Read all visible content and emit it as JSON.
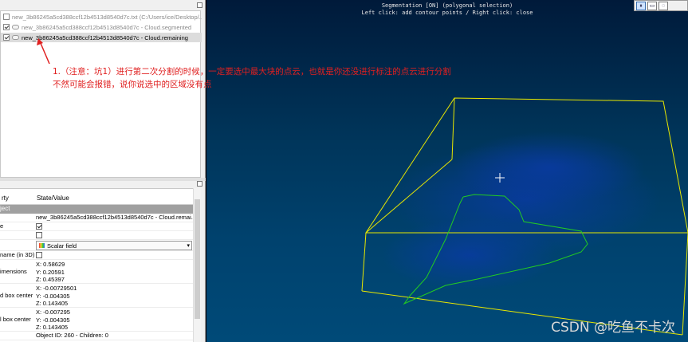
{
  "db_tree": {
    "rows": [
      {
        "label": "new_3b86245a5cd388ccf12b4513d8540d7c.txt (C:/Users/ice/Desktop/...",
        "checked": false,
        "state": "dim"
      },
      {
        "label": "new_3b86245a5cd388ccf12b4513d8540d7c - Cloud.segmented",
        "checked": true,
        "state": "dim"
      },
      {
        "label": "new_3b86245a5cd388ccf12b4513d8540d7c - Cloud.remaining",
        "checked": true,
        "state": "selected"
      }
    ]
  },
  "properties": {
    "header_property": "rty",
    "header_state": "State/Value",
    "group": "ject",
    "name_value": "new_3b86245a5cd388ccf12b4513d8540d7c - Cloud.remai...",
    "key_visible": "e",
    "key_name3d": "name (in 3D)",
    "combo_value": "Scalar field",
    "key_dimensions": "imensions",
    "dim_x": "X: 0.58629",
    "dim_y": "Y: 0.20591",
    "dim_z": "Z: 0.45397",
    "key_local_center": "d box center",
    "lc_x": "X: -0.00729501",
    "lc_y": "Y: -0.004305",
    "lc_z": "Z: 0.143405",
    "key_global_center": "l box center",
    "gc_x": "X: -0.007295",
    "gc_y": "Y: -0.004305",
    "gc_z": "Z: 0.143405",
    "object_id": "Object ID: 260 - Children: 0"
  },
  "view": {
    "title_line1": "Segmentation [ON] (polygonal selection)",
    "title_line2": "Left click: add contour points / Right click: close",
    "toolbar": [
      "pause-icon",
      "polygon-select-icon",
      "lasso-icon"
    ],
    "annotation_line1": "1.（注意：坑1）进行第二次分割的时候，一定要选中最大块的点云，也就是你还没进行标注的点云进行分割",
    "annotation_line2": "不然可能会报错，说你说选中的区域没有点",
    "watermark": "CSDN @吃鱼不卡次",
    "colors": {
      "bbox": "#e8e800",
      "contour": "#22cc22",
      "annotation": "#e02020",
      "background_top": "#001a3a",
      "background_bottom": "#004a78"
    }
  }
}
